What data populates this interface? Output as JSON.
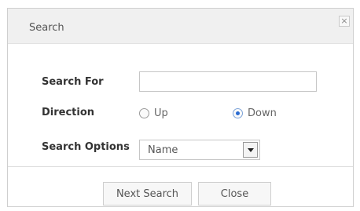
{
  "dialog": {
    "title": "Search",
    "close_glyph": "×"
  },
  "fields": {
    "search_for_label": "Search For",
    "search_for_value": "",
    "direction_label": "Direction",
    "direction_options": [
      {
        "label": "Up",
        "selected": false
      },
      {
        "label": "Down",
        "selected": true
      }
    ],
    "search_options_label": "Search Options",
    "search_options_value": "Name"
  },
  "buttons": {
    "next_search": "Next Search",
    "close": "Close"
  },
  "colors": {
    "titlebar_bg": "#f0f0f0",
    "radio_selected": "#2a6bd1"
  }
}
